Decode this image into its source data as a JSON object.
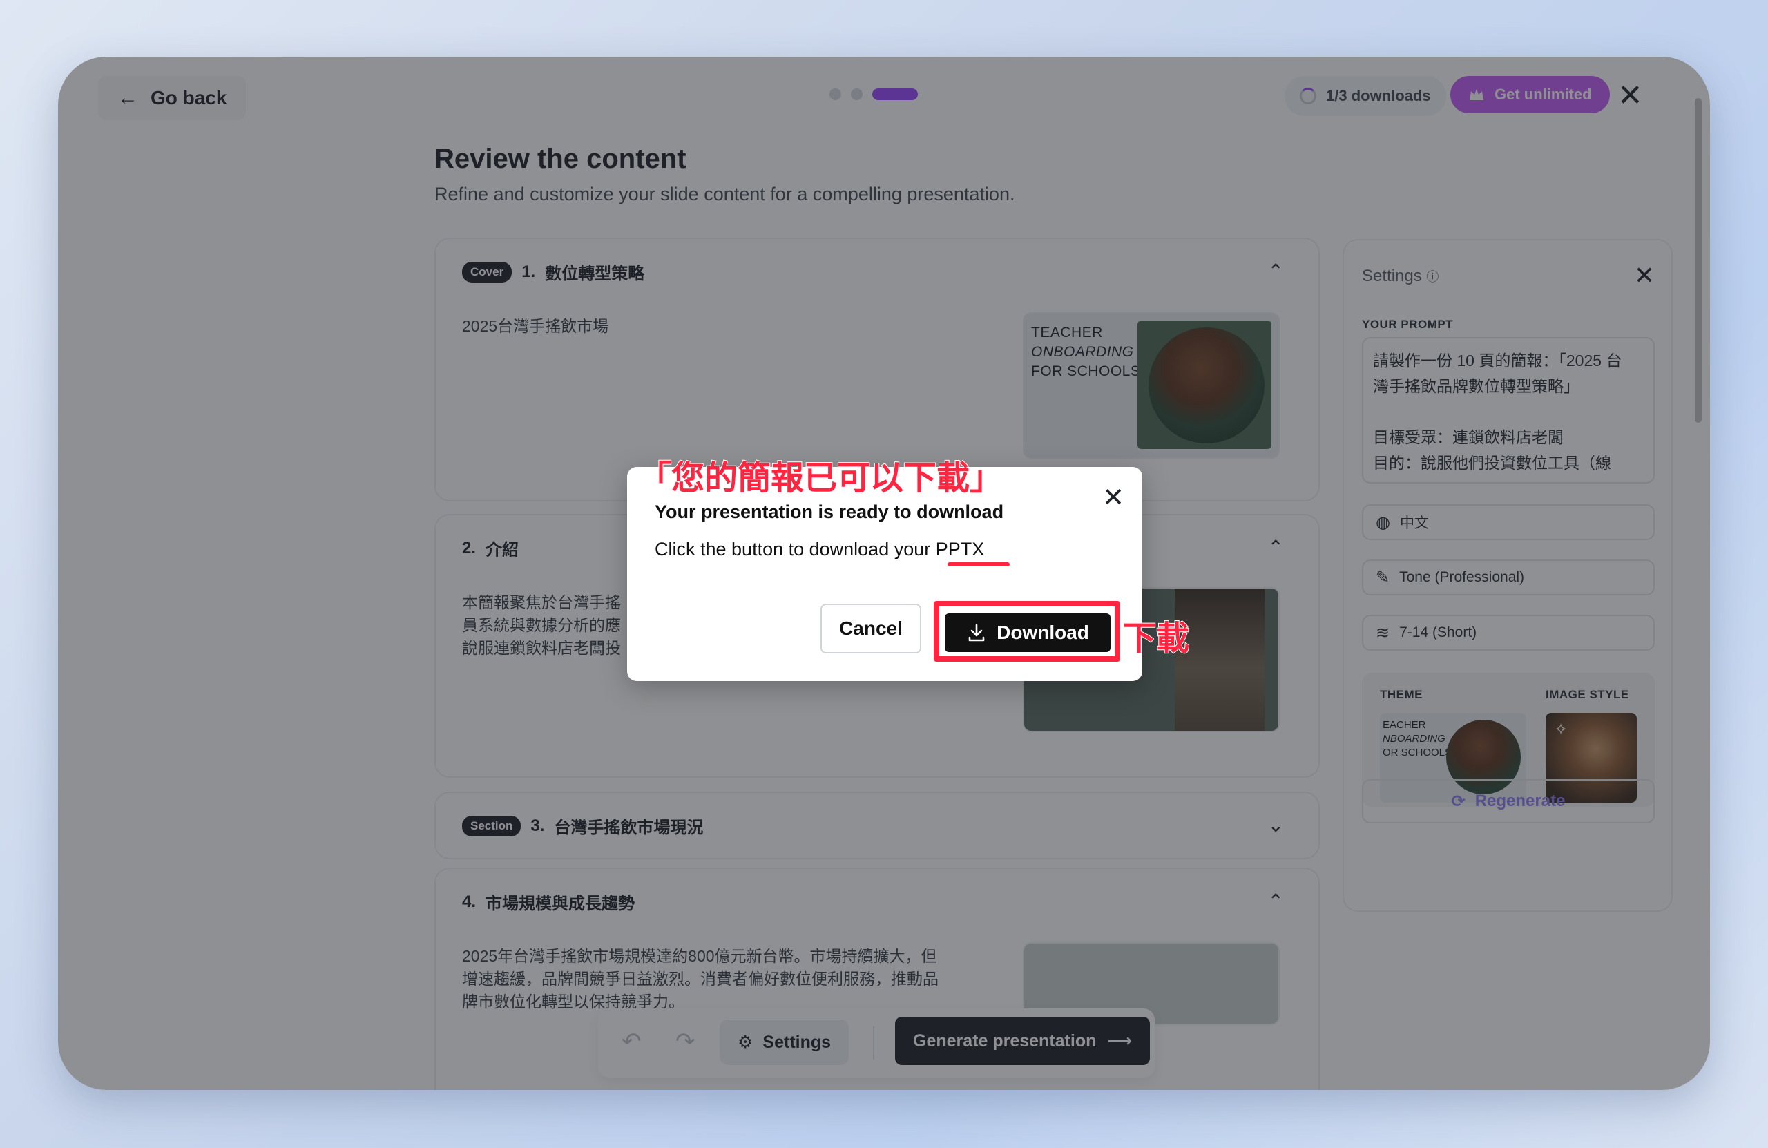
{
  "header": {
    "go_back": "Go back",
    "downloads": "1/3 downloads",
    "get_unlimited": "Get unlimited"
  },
  "page": {
    "title": "Review the content",
    "subtitle": "Refine and customize your slide content for a compelling presentation."
  },
  "slides": [
    {
      "badge": "Cover",
      "number": "1.",
      "title": "數位轉型策略",
      "body": "2025台灣手搖飲市場",
      "thumb": {
        "line1": "TEACHER",
        "line2": "ONBOARDING",
        "line3": "FOR SCHOOLS"
      }
    },
    {
      "badge": "",
      "number": "2.",
      "title": "介紹",
      "body_lines": [
        "本簡報聚焦於台灣手搖",
        "員系統與數據分析的應",
        "說服連鎖飲料店老闆投"
      ]
    },
    {
      "badge": "Section",
      "number": "3.",
      "title": "台灣手搖飲市場現況"
    },
    {
      "badge": "",
      "number": "4.",
      "title": "市場規模與成長趨勢",
      "body_lines": [
        "2025年台灣手搖飲市場規模達約800億元新台幣。市場持續擴大，但",
        "增速趨緩，品牌間競爭日益激烈。消費者偏好數位便利服務，推動品",
        "牌市數位化轉型以保持競爭力。"
      ]
    }
  ],
  "settings_panel": {
    "title": "Settings",
    "prompt_label": "YOUR PROMPT",
    "prompt_lines": [
      "請製作一份 10 頁的簡報：「2025 台",
      "灣手搖飲品牌數位轉型策略」",
      "",
      "目標受眾：連鎖飲料店老闆",
      "目的：說服他們投資數位工具（線"
    ],
    "language": "中文",
    "tone": "Tone (Professional)",
    "length": "7-14 (Short)",
    "theme_label": "THEME",
    "image_style_label": "IMAGE STYLE",
    "theme_thumb": {
      "line1": "EACHER",
      "line2": "NBOARDING",
      "line3": "OR SCHOOLS"
    },
    "regenerate": "Regenerate"
  },
  "toolbar": {
    "settings": "Settings",
    "generate": "Generate presentation"
  },
  "modal": {
    "title": "Your presentation is ready to download",
    "text": "Click the button to download your PPTX",
    "cancel": "Cancel",
    "download": "Download"
  },
  "annotations": {
    "top": "「您的簡報已可以下載」",
    "right": "下載"
  },
  "colors": {
    "accent": "#9b47ff",
    "unlimited_button": "#c55cf6",
    "highlight": "#ff2440",
    "dark": "#1f2328"
  }
}
